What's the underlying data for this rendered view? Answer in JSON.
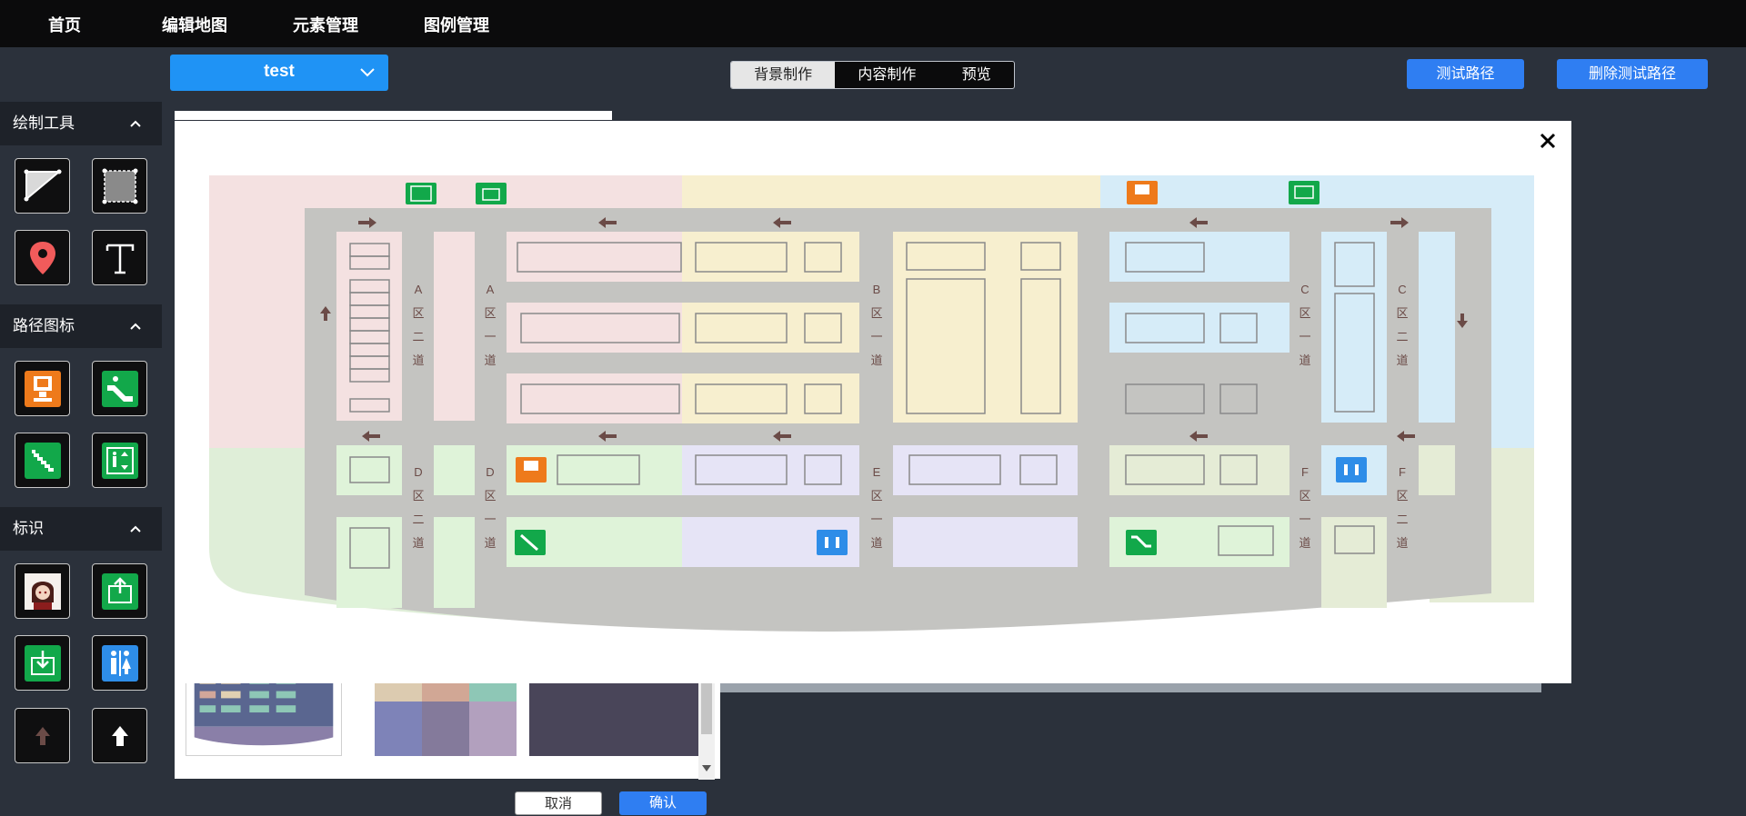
{
  "nav": {
    "items": [
      "首页",
      "编辑地图",
      "元素管理",
      "图例管理"
    ]
  },
  "map_select": {
    "value": "test"
  },
  "mode_tabs": [
    "背景制作",
    "内容制作",
    "预览"
  ],
  "buttons": {
    "test_path": "测试路径",
    "delete_test_path": "删除测试路径"
  },
  "sidebar": {
    "sections": [
      {
        "title": "绘制工具",
        "tools": [
          "polygon-icon",
          "rectangle-icon",
          "location-pin-icon",
          "text-icon"
        ]
      },
      {
        "title": "路径图标",
        "tools": [
          "elevator-icon",
          "escalator-icon",
          "stairs-icon",
          "lift-icon"
        ]
      },
      {
        "title": "标识",
        "tools": [
          "avatar-icon",
          "exit-icon",
          "entrance-icon",
          "restroom-icon",
          "arrow-up-brown-icon",
          "arrow-up-white-icon"
        ]
      }
    ]
  },
  "dialog": {
    "cancel_label": "取消",
    "confirm_label": "确认"
  },
  "map": {
    "zones": {
      "a2": [
        "A",
        "区",
        "二",
        "道"
      ],
      "a1": [
        "A",
        "区",
        "一",
        "道"
      ],
      "b1": [
        "B",
        "区",
        "一",
        "道"
      ],
      "c1": [
        "C",
        "区",
        "一",
        "道"
      ],
      "c2": [
        "C",
        "区",
        "二",
        "道"
      ],
      "d2": [
        "D",
        "区",
        "二",
        "道"
      ],
      "d1": [
        "D",
        "区",
        "一",
        "道"
      ],
      "e1": [
        "E",
        "区",
        "一",
        "道"
      ],
      "f1": [
        "F",
        "区",
        "一",
        "道"
      ],
      "f2": [
        "F",
        "区",
        "二",
        "道"
      ]
    },
    "colors": {
      "pink": "#f4e1e1",
      "yellow": "#f7efcf",
      "blue": "#d6ecf8",
      "green": "#dff3d9",
      "lavender": "#e6e4f6",
      "road": "#c2c2bf",
      "accent_blue": "#2f7ef2",
      "select_blue": "#1f93f5"
    }
  }
}
